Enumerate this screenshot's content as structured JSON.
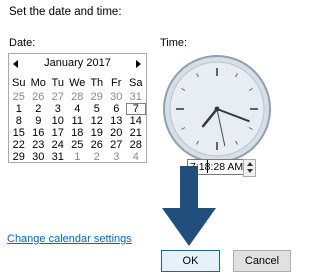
{
  "dialog": {
    "heading": "Set the date and time:",
    "date_label": "Date:",
    "time_label": "Time:"
  },
  "calendar": {
    "month_title": "January 2017",
    "weekdays": [
      "Su",
      "Mo",
      "Tu",
      "We",
      "Th",
      "Fr",
      "Sa"
    ],
    "weeks": [
      [
        "25",
        "26",
        "27",
        "28",
        "29",
        "30",
        "31"
      ],
      [
        "1",
        "2",
        "3",
        "4",
        "5",
        "6",
        "7"
      ],
      [
        "8",
        "9",
        "10",
        "11",
        "12",
        "13",
        "14"
      ],
      [
        "15",
        "16",
        "17",
        "18",
        "19",
        "20",
        "21"
      ],
      [
        "22",
        "23",
        "24",
        "25",
        "26",
        "27",
        "28"
      ],
      [
        "29",
        "30",
        "31",
        "1",
        "2",
        "3",
        "4"
      ]
    ],
    "muted_first_row": true,
    "muted_last_row_from": 3,
    "today": "7"
  },
  "clock": {
    "hour": 7,
    "minute": 18,
    "second": 28,
    "face_color": "#e8edf3",
    "rim_color": "#8fa0b2"
  },
  "time": {
    "hour_text": "7:18",
    "rest_text": ":28 AM"
  },
  "link": {
    "text": "Change calendar settings"
  },
  "buttons": {
    "ok": "OK",
    "cancel": "Cancel"
  },
  "overlay": {
    "arrow_color": "#1f4f7a"
  }
}
